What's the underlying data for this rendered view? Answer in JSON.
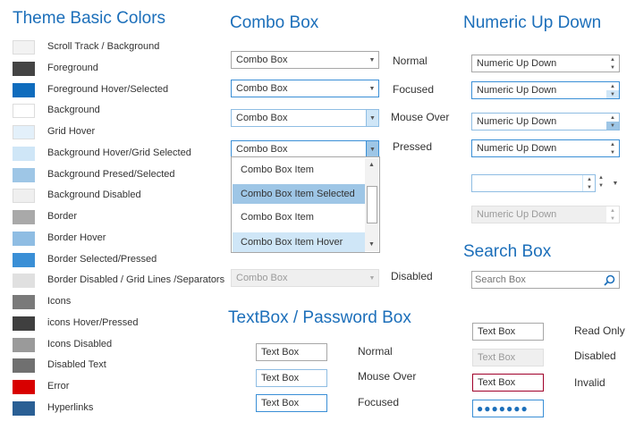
{
  "theme": {
    "heading": "Theme Basic Colors",
    "items": [
      {
        "label": "Scroll Track / Background",
        "color": "#f2f2f2"
      },
      {
        "label": "Foreground",
        "color": "#444444"
      },
      {
        "label": "Foreground Hover/Selected",
        "color": "#0f6cbd"
      },
      {
        "label": "Background",
        "color": "#ffffff"
      },
      {
        "label": "Grid Hover",
        "color": "#e3f0fa"
      },
      {
        "label": "Background Hover/Grid Selected",
        "color": "#cfe6f7"
      },
      {
        "label": "Background Presed/Selected",
        "color": "#9ec6e6"
      },
      {
        "label": "Background Disabled",
        "color": "#efefef"
      },
      {
        "label": "Border",
        "color": "#a9a9a9"
      },
      {
        "label": "Border Hover",
        "color": "#8fbde3"
      },
      {
        "label": "Border Selected/Pressed",
        "color": "#3a8fd6"
      },
      {
        "label": "Border Disabled / Grid Lines /Separators",
        "color": "#e0e0e0"
      },
      {
        "label": "Icons",
        "color": "#7a7a7a"
      },
      {
        "label": "icons Hover/Pressed",
        "color": "#3f3f3f"
      },
      {
        "label": "Icons Disabled",
        "color": "#9a9a9a"
      },
      {
        "label": "Disabled Text",
        "color": "#707070"
      },
      {
        "label": "Error",
        "color": "#d80000"
      },
      {
        "label": "Hyperlinks",
        "color": "#2a5f94"
      }
    ]
  },
  "combo": {
    "heading": "Combo Box",
    "value": "Combo Box",
    "states": [
      "Normal",
      "Focused",
      "Mouse Over",
      "Pressed"
    ],
    "disabled_value": "Combo Box",
    "disabled_state": "Disabled",
    "dropdown_items": [
      "Combo Box Item",
      "Combo Box Item Selected",
      "Combo Box Item",
      "Combo Box Item Hover"
    ]
  },
  "nud": {
    "heading": "Numeric Up Down",
    "value": "Numeric Up Down"
  },
  "search": {
    "heading": "Search Box",
    "placeholder": "Search Box"
  },
  "textbox": {
    "heading": "TextBox / Password Box",
    "value": "Text Box",
    "states": [
      "Normal",
      "Mouse Over",
      "Focused"
    ],
    "right_states": [
      "Read Only",
      "Disabled",
      "Invalid"
    ],
    "password_mask": "●●●●●●●"
  }
}
